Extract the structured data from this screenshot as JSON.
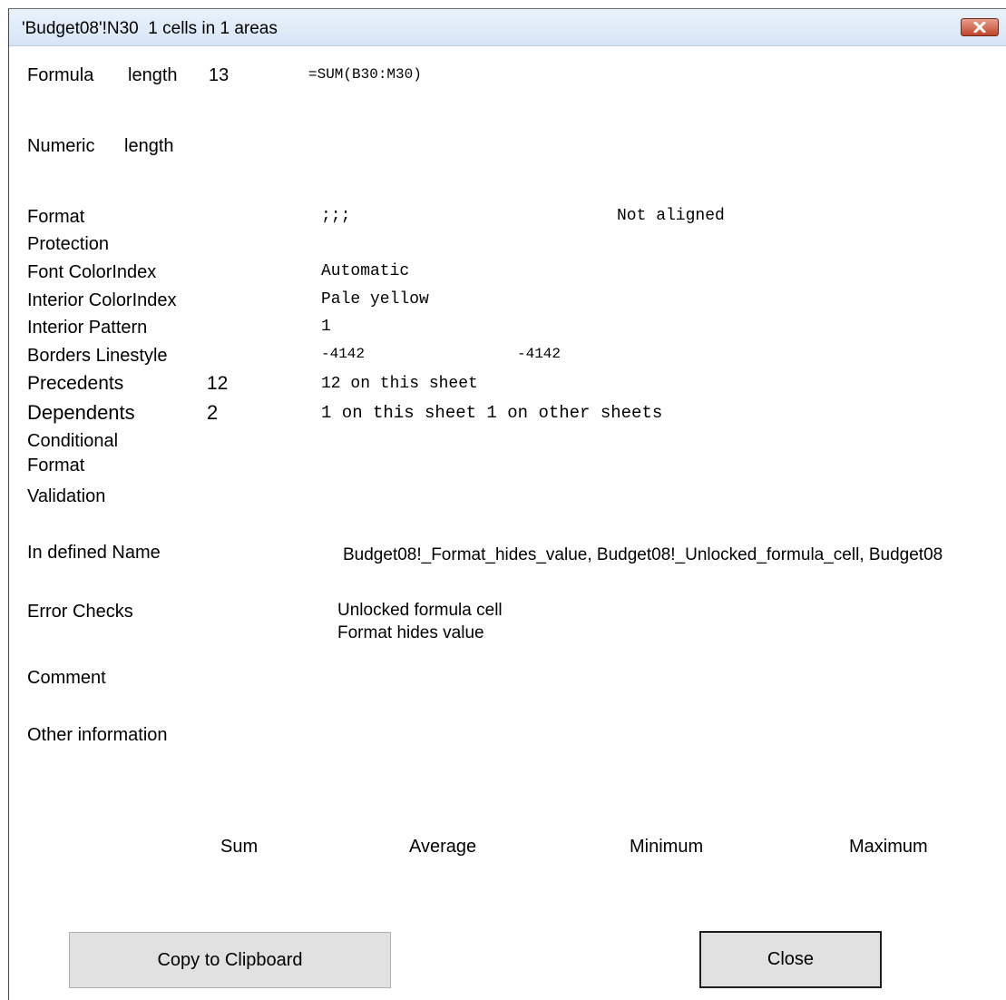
{
  "window": {
    "title": "'Budget08'!N30  1 cells in 1 areas",
    "close_icon": "close-x-icon"
  },
  "formula": {
    "label": "Formula",
    "length_label": "length",
    "length_value": "13",
    "value": "=SUM(B30:M30)"
  },
  "numeric": {
    "label": "Numeric",
    "length_label": "length"
  },
  "format": {
    "label": "Format",
    "value": ";;;",
    "alignment": "Not aligned"
  },
  "protection": {
    "label": "Protection"
  },
  "font_colorindex": {
    "label": "Font ColorIndex",
    "value": "Automatic"
  },
  "interior_colorindex": {
    "label": "Interior ColorIndex",
    "value": "Pale yellow"
  },
  "interior_pattern": {
    "label": "Interior Pattern",
    "value": "1"
  },
  "borders_linestyle": {
    "label": "Borders Linestyle",
    "value1": "-4142",
    "value2": "-4142"
  },
  "precedents": {
    "label": "Precedents",
    "count": "12",
    "value": "12 on this sheet"
  },
  "dependents": {
    "label": "Dependents",
    "count": "2",
    "value": "1 on this sheet 1 on other sheets"
  },
  "conditional_format": {
    "label_line1": "Conditional",
    "label_line2": "Format"
  },
  "validation": {
    "label": "Validation"
  },
  "defined_name": {
    "label": "In defined Name",
    "value": "Budget08!_Format_hides_value, Budget08!_Unlocked_formula_cell, Budget08"
  },
  "error_checks": {
    "label": "Error Checks",
    "line1": "Unlocked formula cell",
    "line2": "Format hides value"
  },
  "comment": {
    "label": "Comment"
  },
  "other_information": {
    "label": "Other information"
  },
  "stats": {
    "sum": "Sum",
    "average": "Average",
    "minimum": "Minimum",
    "maximum": "Maximum"
  },
  "buttons": {
    "copy": "Copy to Clipboard",
    "close": "Close"
  }
}
